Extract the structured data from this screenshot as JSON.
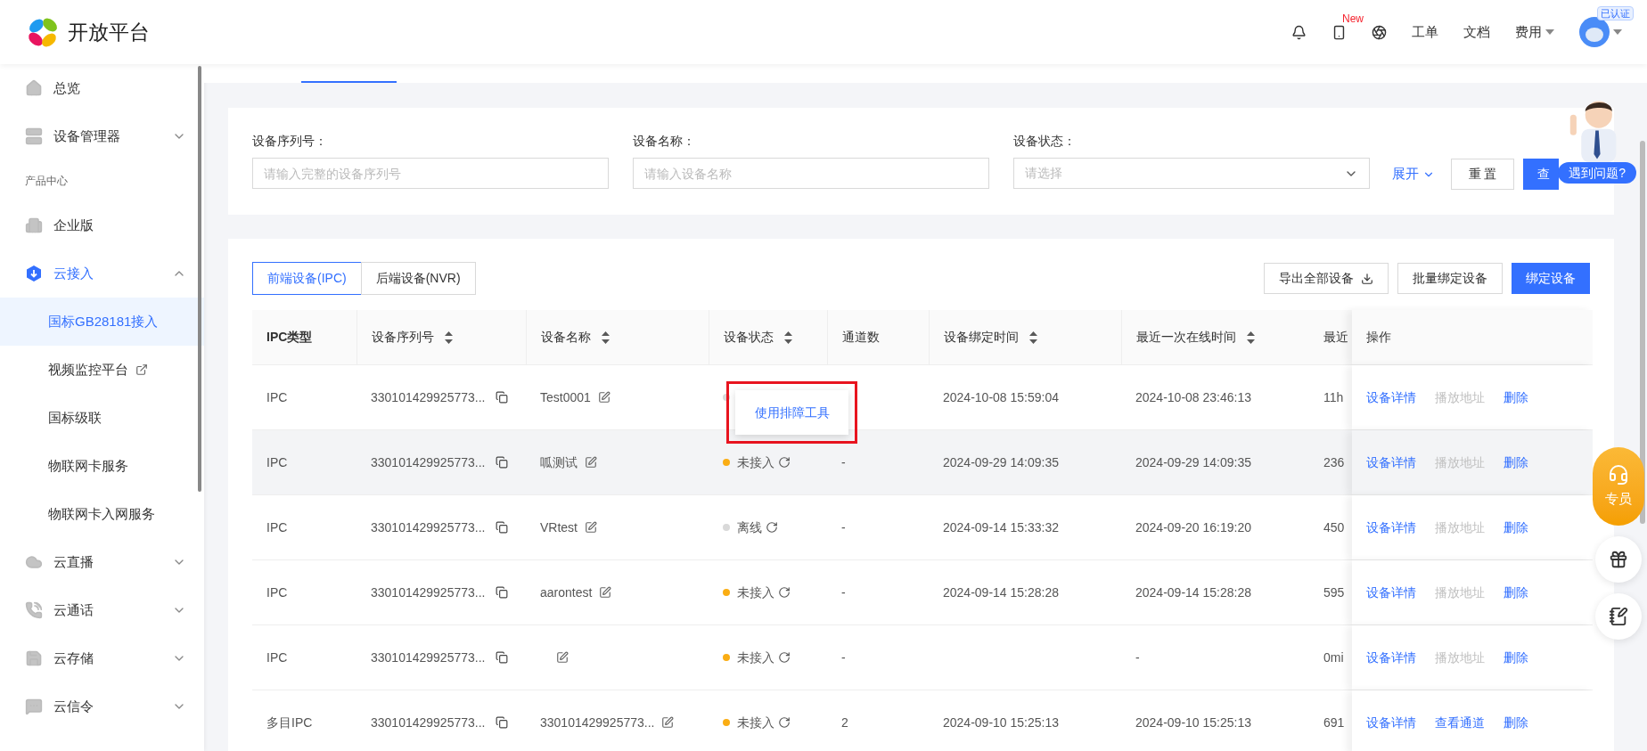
{
  "header": {
    "logo_text": "开放平台",
    "new_badge": "New",
    "links": [
      {
        "label": "工单",
        "dropdown": false
      },
      {
        "label": "文档",
        "dropdown": false
      },
      {
        "label": "费用",
        "dropdown": true
      }
    ],
    "verified_badge": "已认证"
  },
  "sidebar": {
    "items": [
      {
        "label": "总览",
        "selected": false,
        "active": false
      },
      {
        "label": "设备管理器",
        "selected": false,
        "active": false,
        "expanded": false
      }
    ],
    "sections": [
      {
        "title": "产品中心",
        "items": [
          {
            "label": "企业版",
            "selected": false,
            "active": false
          },
          {
            "label": "云接入",
            "selected": false,
            "active": true,
            "expanded": true,
            "children": [
              {
                "label": "国标GB28181接入",
                "selected": true,
                "external": false
              },
              {
                "label": "视频监控平台",
                "selected": false,
                "external": true
              },
              {
                "label": "国标级联",
                "selected": false,
                "external": false
              },
              {
                "label": "物联网卡服务",
                "selected": false,
                "external": false
              },
              {
                "label": "物联网卡入网服务",
                "selected": false,
                "external": false
              }
            ]
          },
          {
            "label": "云直播",
            "selected": false,
            "active": false,
            "expanded": false
          },
          {
            "label": "云通话",
            "selected": false,
            "active": false,
            "expanded": false
          },
          {
            "label": "云存储",
            "selected": false,
            "active": false,
            "expanded": false
          },
          {
            "label": "云信令",
            "selected": false,
            "active": false,
            "expanded": false
          }
        ]
      }
    ]
  },
  "filters": {
    "fields": [
      {
        "kind": "input",
        "label": "设备序列号：",
        "placeholder": "请输入完整的设备序列号"
      },
      {
        "kind": "input",
        "label": "设备名称：",
        "placeholder": "请输入设备名称"
      },
      {
        "kind": "select",
        "label": "设备状态：",
        "placeholder": "请选择"
      }
    ],
    "expand_link": "展开",
    "reset_button": "重 置",
    "query_button": "查"
  },
  "device_tabs": [
    {
      "label": "前端设备(IPC)",
      "selected": true
    },
    {
      "label": "后端设备(NVR)",
      "selected": false
    }
  ],
  "toolbar_buttons": [
    {
      "kind": "export",
      "label": "导出全部设备"
    },
    {
      "kind": "default",
      "label": "批量绑定设备"
    },
    {
      "kind": "primary",
      "label": "绑定设备"
    }
  ],
  "table": {
    "columns": [
      {
        "label": "IPC类型",
        "sortable": false
      },
      {
        "label": "设备序列号",
        "sortable": true
      },
      {
        "label": "设备名称",
        "sortable": true
      },
      {
        "label": "设备状态",
        "sortable": true
      },
      {
        "label": "通道数",
        "sortable": false
      },
      {
        "label": "设备绑定时间",
        "sortable": true
      },
      {
        "label": "最近一次在线时间",
        "sortable": true
      },
      {
        "label": "最近"
      },
      {
        "label": "操作",
        "sortable": false
      }
    ],
    "rows": [
      {
        "hovered": false,
        "type": "IPC",
        "serial": "330101429925773...",
        "name": "Test0001",
        "status": {
          "color": "#d9d9d9"
        },
        "bound_at": "2024-10-08 15:59:04",
        "last_online": "2024-10-08 23:46:13",
        "column_8": "11h",
        "actions": [
          {
            "label": "设备详情",
            "disabled": false
          },
          {
            "label": "播放地址",
            "disabled": true
          },
          {
            "label": "删除",
            "disabled": false
          }
        ]
      },
      {
        "hovered": true,
        "type": "IPC",
        "serial": "330101429925773...",
        "name": "呱测试",
        "status": {
          "text": "未接入",
          "color": "#faad14"
        },
        "channels": "-",
        "bound_at": "2024-09-29 14:09:35",
        "last_online": "2024-09-29 14:09:35",
        "column_8": "236",
        "actions": [
          {
            "label": "设备详情",
            "disabled": false
          },
          {
            "label": "播放地址",
            "disabled": true
          },
          {
            "label": "删除",
            "disabled": false
          }
        ]
      },
      {
        "hovered": false,
        "type": "IPC",
        "serial": "330101429925773...",
        "name": "VRtest",
        "status": {
          "text": "离线",
          "color": "#d9d9d9"
        },
        "channels": "-",
        "bound_at": "2024-09-14 15:33:32",
        "last_online": "2024-09-20 16:19:20",
        "column_8": "450",
        "actions": [
          {
            "label": "设备详情",
            "disabled": false
          },
          {
            "label": "播放地址",
            "disabled": true
          },
          {
            "label": "删除",
            "disabled": false
          }
        ]
      },
      {
        "hovered": false,
        "type": "IPC",
        "serial": "330101429925773...",
        "name": "aarontest",
        "status": {
          "text": "未接入",
          "color": "#faad14"
        },
        "channels": "-",
        "bound_at": "2024-09-14 15:28:28",
        "last_online": "2024-09-14 15:28:28",
        "column_8": "595",
        "actions": [
          {
            "label": "设备详情",
            "disabled": false
          },
          {
            "label": "播放地址",
            "disabled": true
          },
          {
            "label": "删除",
            "disabled": false
          }
        ]
      },
      {
        "hovered": false,
        "type": "IPC",
        "serial": "330101429925773...",
        "status": {
          "text": "未接入",
          "color": "#faad14"
        },
        "channels": "-",
        "last_online": "-",
        "column_8": "0mi",
        "actions": [
          {
            "label": "设备详情",
            "disabled": false
          },
          {
            "label": "播放地址",
            "disabled": true
          },
          {
            "label": "删除",
            "disabled": false
          }
        ]
      },
      {
        "hovered": false,
        "type": "多目IPC",
        "serial": "330101429925773...",
        "name": "330101429925773...",
        "status": {
          "text": "未接入",
          "color": "#faad14"
        },
        "channels": "2",
        "bound_at": "2024-09-10 15:25:13",
        "last_online": "2024-09-10 15:25:13",
        "column_8": "691",
        "actions": [
          {
            "label": "设备详情",
            "disabled": false
          },
          {
            "label": "查看通道",
            "disabled": false
          },
          {
            "label": "删除",
            "disabled": false
          }
        ]
      }
    ]
  },
  "tooltip": {
    "text": "使用排障工具",
    "outlined": true
  },
  "assistant": {
    "bubble": "遇到问题?"
  },
  "float_buttons": {
    "agent_label": "专员"
  }
}
